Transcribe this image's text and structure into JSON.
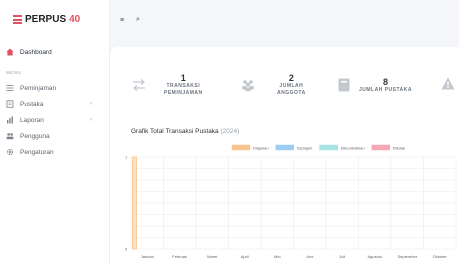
{
  "brand": {
    "name": "PERPUS",
    "number": "40"
  },
  "sidebar": {
    "dashboard": "Dashboard",
    "menu_header": "MENU",
    "items": [
      {
        "label": "Peminjaman",
        "icon": "list-icon",
        "chevron": false
      },
      {
        "label": "Pustaka",
        "icon": "book-icon",
        "chevron": true
      },
      {
        "label": "Laporan",
        "icon": "report-icon",
        "chevron": true
      },
      {
        "label": "Pengguna",
        "icon": "users-icon",
        "chevron": false
      },
      {
        "label": "Pengaturan",
        "icon": "gear-icon",
        "chevron": false
      }
    ]
  },
  "topbar": {
    "menu_icon": "≡",
    "search_icon": "⌕"
  },
  "stats": [
    {
      "value": "1",
      "label_line1": "TRANSAKSI",
      "label_line2": "PEMINJAMAN",
      "icon": "transfer-icon"
    },
    {
      "value": "2",
      "label_line1": "JUMLAH",
      "label_line2": "ANGGOTA",
      "icon": "users-icon"
    },
    {
      "value": "8",
      "label_line1": "JUMLAH PUSTAKA",
      "label_line2": "",
      "icon": "book-icon"
    }
  ],
  "chart_title": "Grafik Total Transaksi Pustaka",
  "chart_year": "(2024)",
  "chart_data": {
    "type": "bar",
    "categories": [
      "Januari",
      "Februari",
      "Maret",
      "April",
      "Mei",
      "Juni",
      "Juli",
      "Agustus",
      "September",
      "Oktober"
    ],
    "series": [
      {
        "name": "Diajukan",
        "color": "#f7c68f",
        "values": [
          1,
          0,
          0,
          0,
          0,
          0,
          0,
          0,
          0,
          0
        ]
      },
      {
        "name": "Dipinjam",
        "color": "#9fcdf2",
        "values": [
          0,
          0,
          0,
          0,
          0,
          0,
          0,
          0,
          0,
          0
        ]
      },
      {
        "name": "Dikembalikan",
        "color": "#a7e3e3",
        "values": [
          0,
          0,
          0,
          0,
          0,
          0,
          0,
          0,
          0,
          0
        ]
      },
      {
        "name": "Ditolak",
        "color": "#f7a8b5",
        "values": [
          0,
          0,
          0,
          0,
          0,
          0,
          0,
          0,
          0,
          0
        ]
      }
    ],
    "yticks": [
      "1",
      "0"
    ],
    "ylim": [
      0,
      1
    ],
    "grid": true,
    "legend": "top-center"
  }
}
